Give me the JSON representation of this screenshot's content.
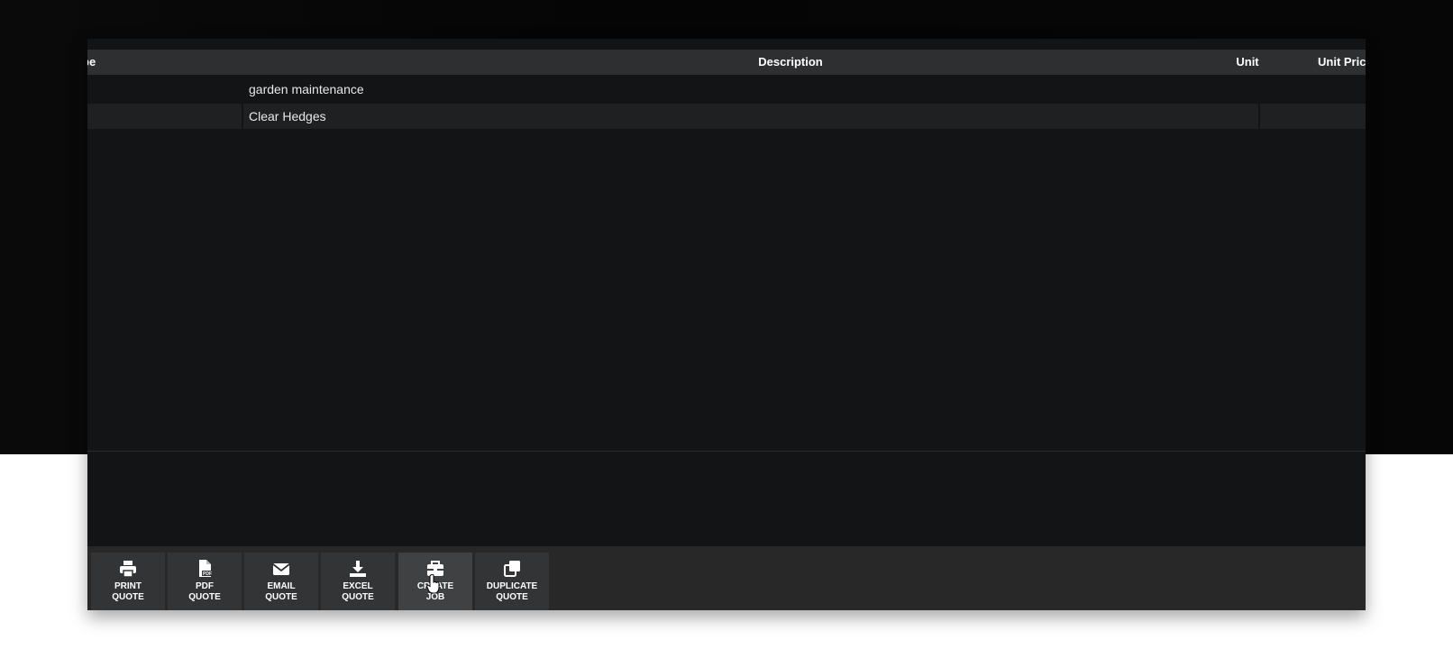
{
  "table": {
    "headers": {
      "type": "pe",
      "description": "Description",
      "unit": "Unit",
      "unit_price": "Unit Pric"
    },
    "rows": [
      {
        "description": "garden maintenance",
        "unit_symbol": "£"
      },
      {
        "description": "Clear Hedges",
        "unit_symbol": "£"
      }
    ]
  },
  "toolbar": {
    "buttons": [
      {
        "line1": "PRINT",
        "line2": "QUOTE",
        "icon": "print-icon"
      },
      {
        "line1": "PDF",
        "line2": "QUOTE",
        "icon": "pdf-icon"
      },
      {
        "line1": "EMAIL",
        "line2": "QUOTE",
        "icon": "email-icon"
      },
      {
        "line1": "EXCEL",
        "line2": "QUOTE",
        "icon": "download-icon"
      },
      {
        "line1": "CREATE",
        "line2": "JOB",
        "icon": "toolbox-icon"
      },
      {
        "line1": "DUPLICATE",
        "line2": "QUOTE",
        "icon": "copy-icon"
      }
    ]
  },
  "colors": {
    "page_background": "#ffffff",
    "panel_background": "#131416",
    "header_background": "#2e2f31",
    "toolbar_background": "#282828",
    "button_background": "#333435"
  }
}
